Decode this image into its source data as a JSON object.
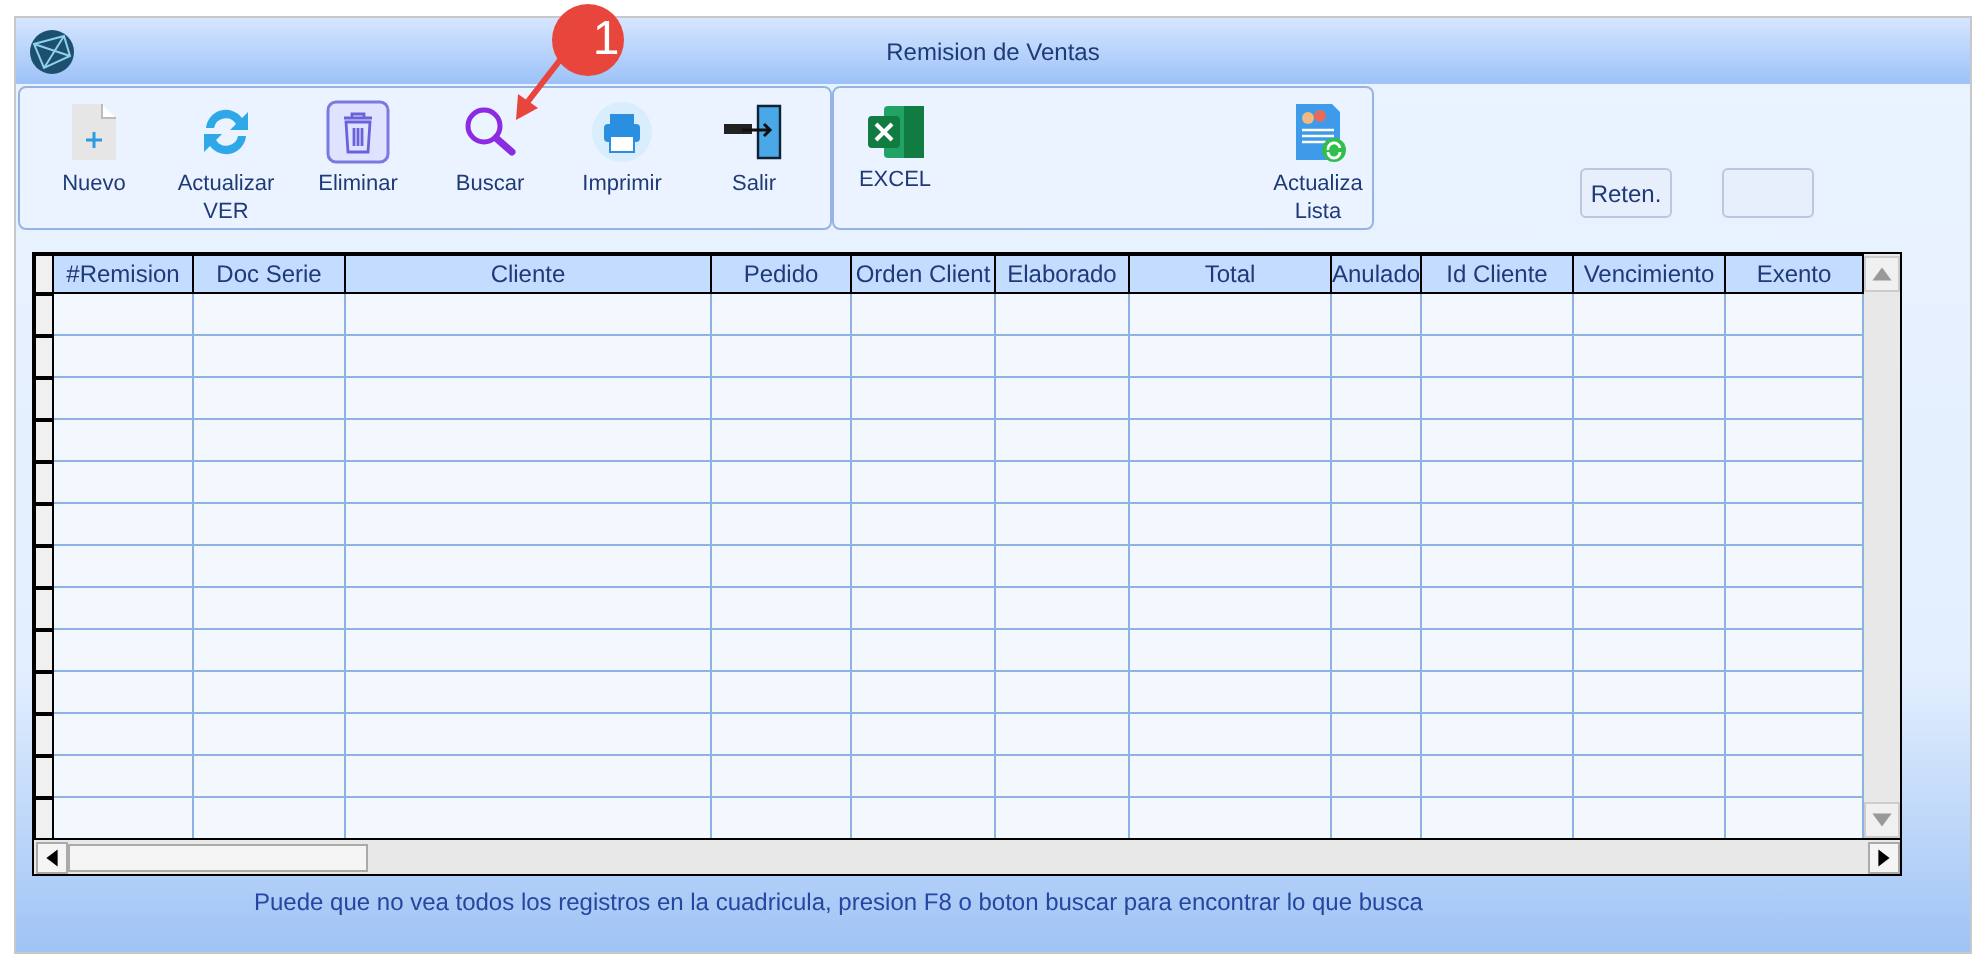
{
  "window": {
    "title": "Remision de Ventas"
  },
  "toolbar": [
    {
      "label": "Nuevo",
      "kind": "new"
    },
    {
      "label": "Actualizar\nVER",
      "kind": "refresh"
    },
    {
      "label": "Eliminar",
      "kind": "delete"
    },
    {
      "label": "Buscar",
      "kind": "search"
    },
    {
      "label": "Imprimir",
      "kind": "print"
    },
    {
      "label": "Salir",
      "kind": "exit"
    }
  ],
  "toolbar_2": [
    {
      "label": "EXCEL",
      "kind": "excel"
    },
    {
      "label": "Actualiza\nLista",
      "kind": "list"
    }
  ],
  "reten_button": "Reten.",
  "callout": "1",
  "table": {
    "columns": [
      "#Remision",
      "Doc Serie",
      "Cliente",
      "Pedido",
      "Orden Client",
      "Elaborado",
      "Total",
      "Anulado",
      "Id Cliente",
      "Vencimiento",
      "Exento"
    ]
  },
  "status_bar": "Puede que no vea todos los registros en la cuadricula, presion F8 o boton buscar para encontrar lo que busca"
}
